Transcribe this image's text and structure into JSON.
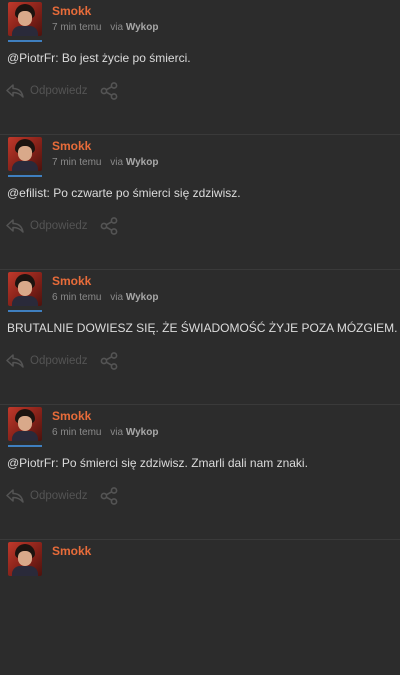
{
  "comments": [
    {
      "username": "Smokk",
      "time": "7 min temu",
      "via_prefix": "via",
      "via_source": "Wykop",
      "mention": "@PiotrFr",
      "text": ": Bo jest życie po śmierci.",
      "reply_label": "Odpowiedz"
    },
    {
      "username": "Smokk",
      "time": "7 min temu",
      "via_prefix": "via",
      "via_source": "Wykop",
      "mention": "@efilist",
      "text": ": Po czwarte po śmierci się zdziwisz.",
      "reply_label": "Odpowiedz"
    },
    {
      "username": "Smokk",
      "time": "6 min temu",
      "via_prefix": "via",
      "via_source": "Wykop",
      "mention": "",
      "text": "BRUTALNIE DOWIESZ SIĘ. ŻE ŚWIADOMOŚĆ ŻYJE POZA MÓZGIEM.",
      "reply_label": "Odpowiedz"
    },
    {
      "username": "Smokk",
      "time": "6 min temu",
      "via_prefix": "via",
      "via_source": "Wykop",
      "mention": "@PiotrFr",
      "text": ": Po śmierci się zdziwisz. Zmarli dali nam znaki.",
      "reply_label": "Odpowiedz"
    },
    {
      "username": "Smokk",
      "time": "",
      "via_prefix": "",
      "via_source": "",
      "mention": "",
      "text": "",
      "reply_label": ""
    }
  ],
  "icons": {
    "reply": "reply-arrow-icon",
    "share": "share-icon"
  },
  "colors": {
    "background": "#2c2c2c",
    "username": "#e86c3a",
    "text": "#dcdcdc",
    "meta": "#8a8a8a",
    "action": "#545454",
    "avatar_underline": "#3f7fbf"
  }
}
